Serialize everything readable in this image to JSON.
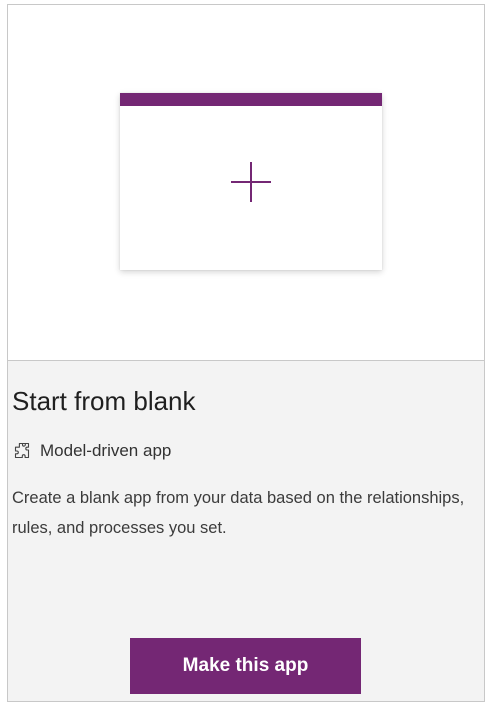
{
  "template": {
    "title": "Start from blank",
    "app_type": {
      "icon": "puzzle-piece-icon",
      "label": "Model-driven app"
    },
    "description": "Create a blank app from your data based on the relationships, rules, and processes you set.",
    "preview": {
      "icon": "plus-icon"
    }
  },
  "actions": {
    "make_app_label": "Make this app"
  },
  "colors": {
    "accent": "#742774",
    "card_background": "#f3f3f3",
    "preview_background": "#ffffff"
  }
}
